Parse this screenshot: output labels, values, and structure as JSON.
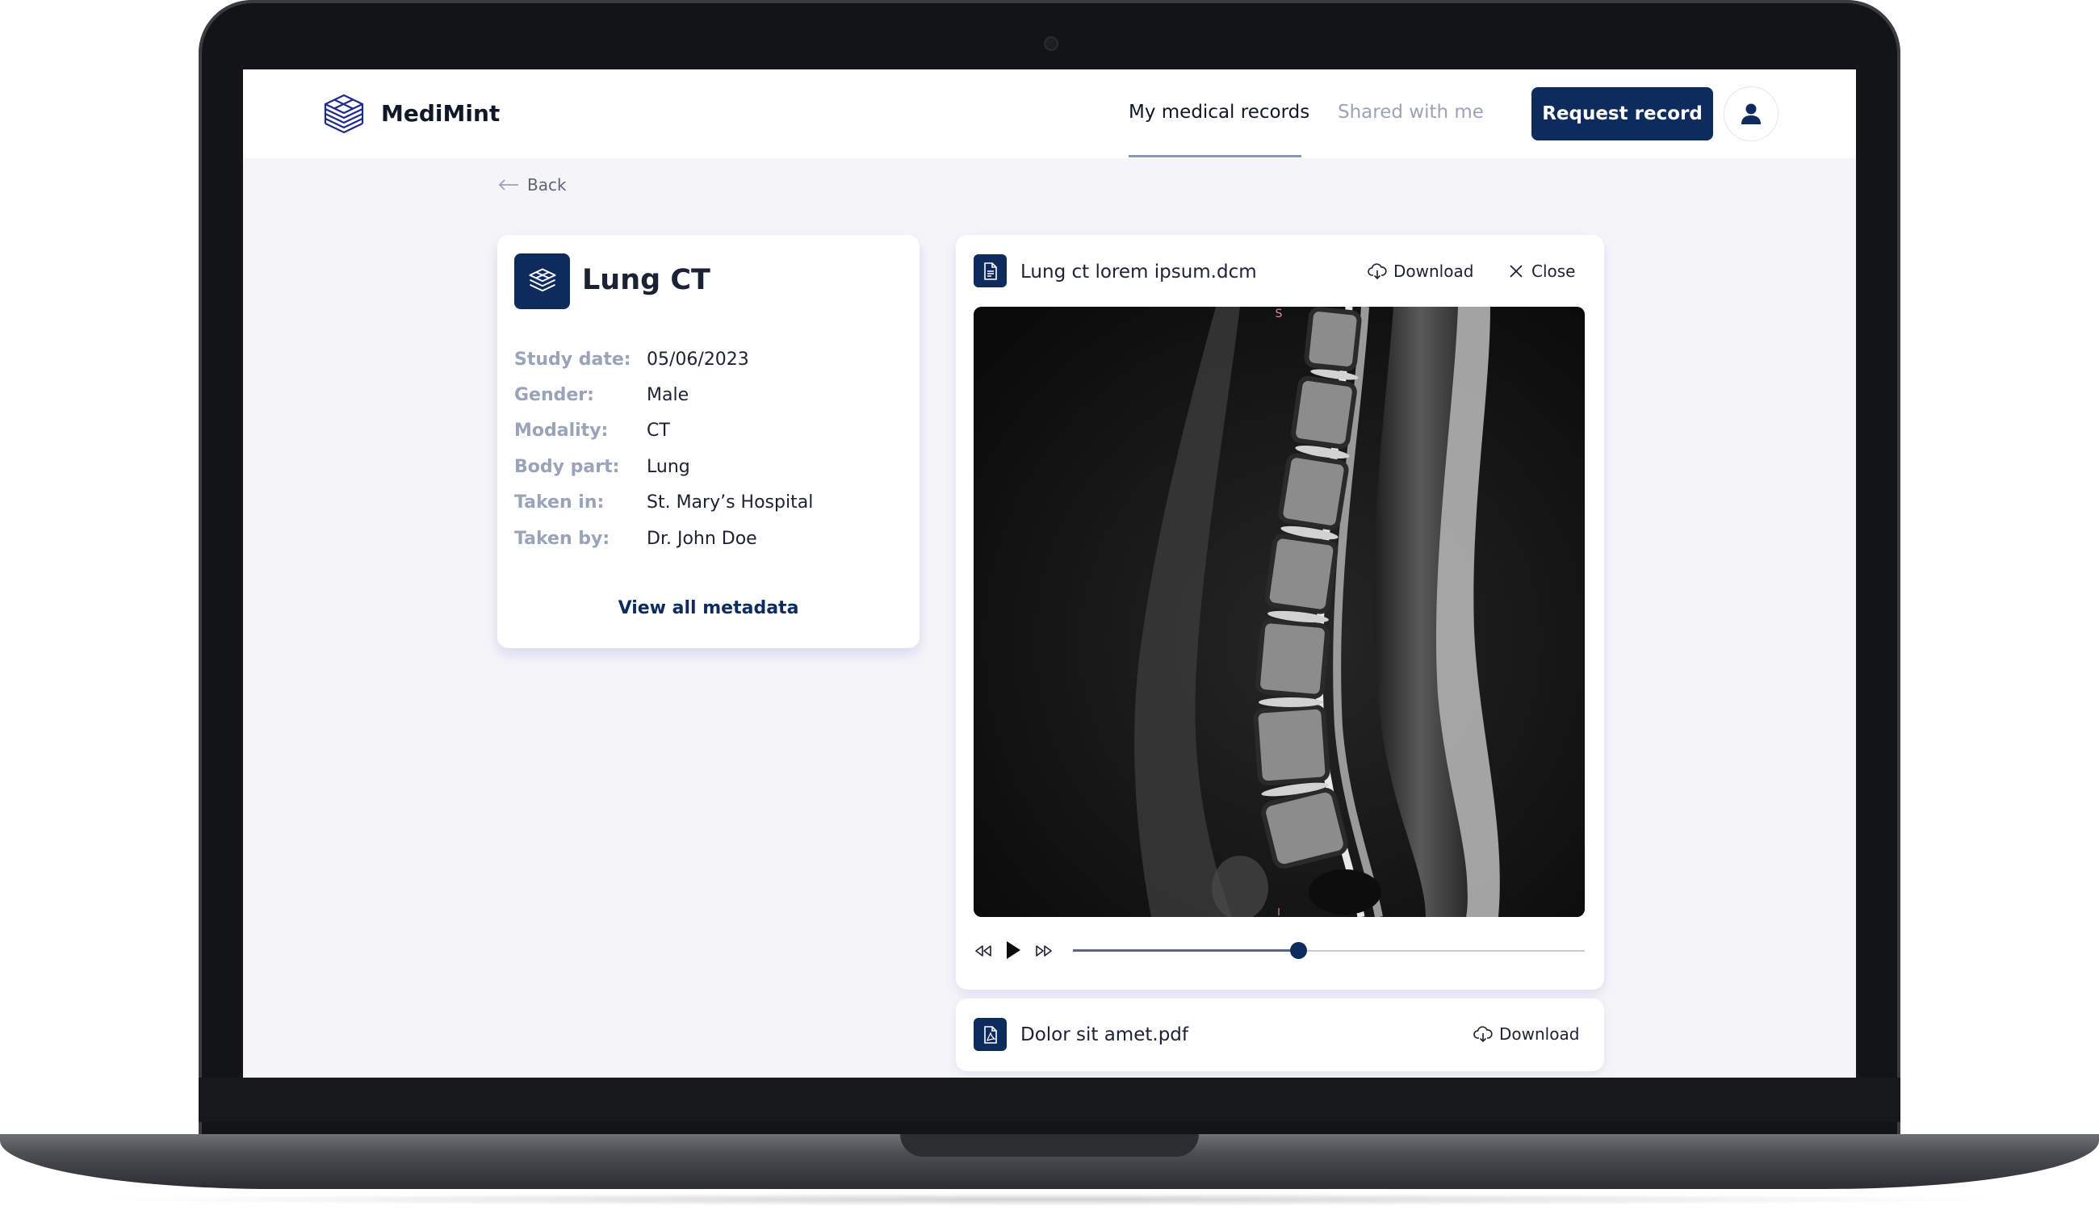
{
  "app": {
    "brand": "MediMint",
    "accent_color": "#0e2b5e"
  },
  "nav": {
    "items": [
      {
        "label": "My medical records",
        "active": true
      },
      {
        "label": "Shared with me",
        "active": false
      }
    ],
    "request_button": "Request record",
    "user_icon": "user-icon"
  },
  "back_label": "Back",
  "record": {
    "title": "Lung CT",
    "fields": [
      {
        "label": "Study date:",
        "value": "05/06/2023"
      },
      {
        "label": "Gender:",
        "value": "Male"
      },
      {
        "label": "Modality:",
        "value": "CT"
      },
      {
        "label": "Body part:",
        "value": "Lung"
      },
      {
        "label": "Taken in:",
        "value": "St. Mary’s Hospital"
      },
      {
        "label": "Taken by:",
        "value": "Dr. John Doe"
      }
    ],
    "view_all": "View all metadata"
  },
  "viewer": {
    "file_name": "Lung ct lorem ipsum.dcm",
    "download_label": "Download",
    "close_label": "Close",
    "orientation_top": "S",
    "orientation_bottom": "I",
    "playback_progress": 0.44
  },
  "attachment": {
    "file_name": "Dolor sit amet.pdf",
    "download_label": "Download"
  }
}
